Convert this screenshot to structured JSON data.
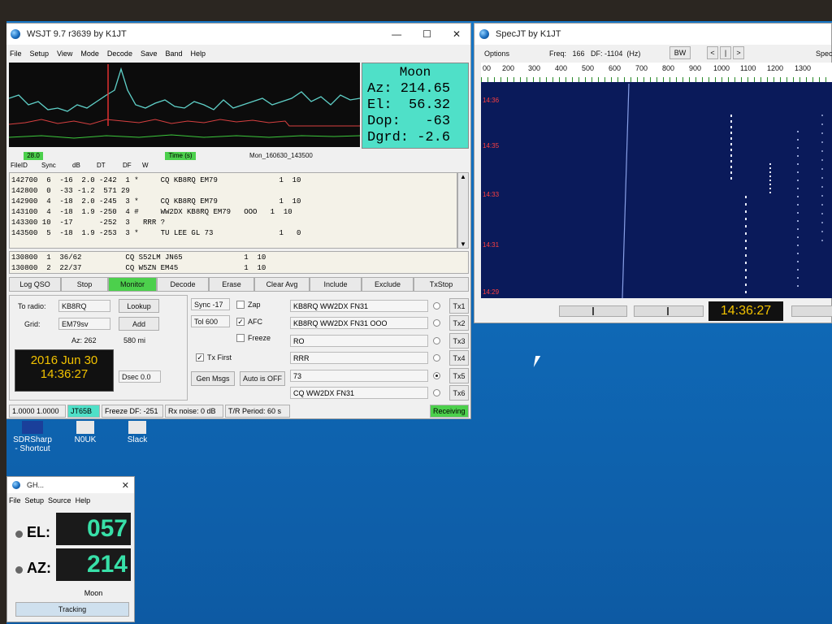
{
  "wsjt": {
    "title": "WSJT 9.7   r3639    by K1JT",
    "menu": [
      "File",
      "Setup",
      "View",
      "Mode",
      "Decode",
      "Save",
      "Band",
      "Help"
    ],
    "moon": {
      "title": "Moon",
      "az": "Az: 214.65",
      "el": "El:  56.32",
      "dop": "Dop:   -63",
      "dgrd": "Dgrd: -2.6"
    },
    "scale_left": "28.0",
    "scale_mid": "Time (s)",
    "filename": "Mon_160630_143500",
    "headers": [
      "FileID",
      "Sync",
      "dB",
      "DT",
      "DF",
      "W"
    ],
    "decodes": [
      "142700  6  -16  2.0 -242  1 *     CQ KB8RQ EM79              1  10",
      "142800  0  -33 -1.2  571 29",
      "142900  4  -18  2.0 -245  3 *     CQ KB8RQ EM79              1  10",
      "143100  4  -18  1.9 -250  4 #     WW2DX KB8RQ EM79   OOO   1  10",
      "143300 10  -17      -252  3   RRR ?",
      "143500  5  -18  1.9 -253  3 *     TU LEE GL 73               1   0"
    ],
    "avg": [
      "130800  1  36/62          CQ S52LM JN65              1  10",
      "130800  2  22/37          CQ W5ZN EM45               1  10"
    ],
    "buttons": {
      "logqso": "Log QSO",
      "stop": "Stop",
      "monitor": "Monitor",
      "decode": "Decode",
      "erase": "Erase",
      "clearavg": "Clear Avg",
      "include": "Include",
      "exclude": "Exclude",
      "txstop": "TxStop"
    },
    "toradio_label": "To radio:",
    "toradio_value": "KB8RQ",
    "grid_label": "Grid:",
    "grid_value": "EM79sv",
    "lookup": "Lookup",
    "add": "Add",
    "az": "Az: 262",
    "dist": "580 mi",
    "date": "2016 Jun 30",
    "time": "14:36:27",
    "dsec": "Dsec  0.0",
    "sync": "Sync  -17",
    "tol": "Tol   600",
    "zap": "Zap",
    "afc": "AFC",
    "freeze": "Freeze",
    "txfirst": "Tx First",
    "genmsgs": "Gen Msgs",
    "autooff": "Auto is OFF",
    "tx_messages": [
      "KB8RQ WW2DX FN31",
      "KB8RQ WW2DX FN31 OOO",
      "RO",
      "RRR",
      "73",
      "CQ WW2DX FN31"
    ],
    "tx_buttons": [
      "Tx1",
      "Tx2",
      "Tx3",
      "Tx4",
      "Tx5",
      "Tx6"
    ],
    "status": {
      "s1": "1.0000 1.0000",
      "mode": "JT65B",
      "freeze": "Freeze DF: -251",
      "noise": "Rx noise:  0 dB",
      "period": "T/R Period: 60 s",
      "rx": "Receiving"
    }
  },
  "spec": {
    "title": "SpecJT    by K1JT",
    "options": "Options",
    "freq": "Freq:   166   DF: -1104  (Hz)",
    "bw": "BW",
    "nav": [
      "<",
      "|",
      ">"
    ],
    "spec_label": "Spec",
    "ticks": [
      "00",
      "200",
      "300",
      "400",
      "500",
      "600",
      "700",
      "800",
      "900",
      "1000",
      "1100",
      "1200",
      "1300"
    ],
    "times": [
      "14:36",
      "14:35",
      "14:33",
      "14:31",
      "14:29"
    ],
    "clock": "14:36:27"
  },
  "gh": {
    "title": "GH...",
    "menu": [
      "File",
      "Setup",
      "Source",
      "Help"
    ],
    "el_label": "EL:",
    "el_value": "057",
    "az_label": "AZ:",
    "az_value": "214",
    "source": "Moon",
    "tracking": "Tracking"
  },
  "desktop": [
    "SDRSharp - Shortcut",
    "N0UK",
    "Slack"
  ],
  "colors": {
    "moon_bg": "#4fe0c8",
    "green": "#4cd04c",
    "spec_bg": "#0a1a5a",
    "clock_bg": "#111111",
    "clock_fg": "#f2c200",
    "gh_fg": "#38e0a8"
  }
}
